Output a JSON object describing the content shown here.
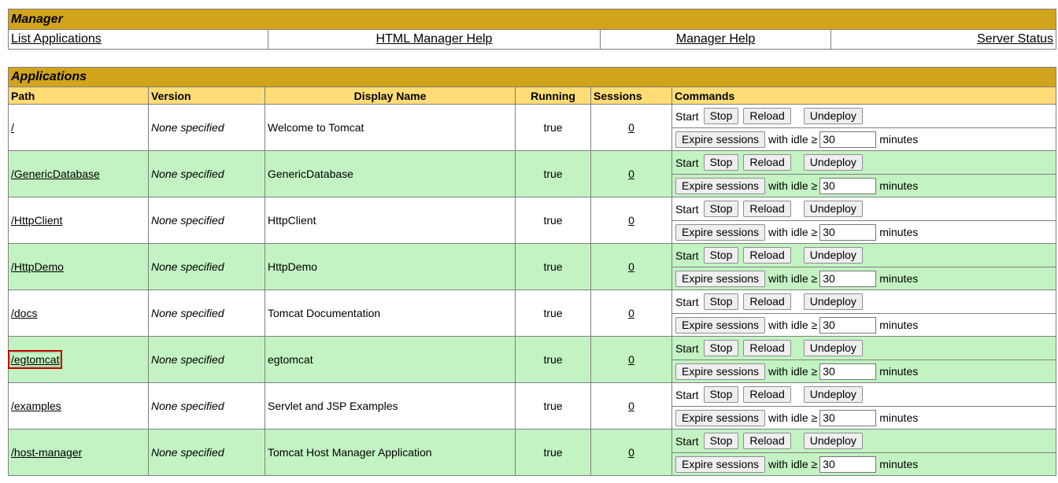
{
  "manager": {
    "title": "Manager",
    "links": [
      "List Applications",
      "HTML Manager Help",
      "Manager Help",
      "Server Status"
    ]
  },
  "applications": {
    "title": "Applications",
    "headers": [
      "Path",
      "Version",
      "Display Name",
      "Running",
      "Sessions",
      "Commands"
    ],
    "labels": {
      "start": "Start",
      "stop": "Stop",
      "reload": "Reload",
      "undeploy": "Undeploy",
      "expire": "Expire sessions",
      "with_idle": "with idle ≥",
      "minutes": "minutes"
    },
    "rows": [
      {
        "path": "/",
        "version": "None specified",
        "display_name": "Welcome to Tomcat",
        "running": "true",
        "sessions": "0",
        "idle": "30"
      },
      {
        "path": "/GenericDatabase",
        "version": "None specified",
        "display_name": "GenericDatabase",
        "running": "true",
        "sessions": "0",
        "idle": "30"
      },
      {
        "path": "/HttpClient",
        "version": "None specified",
        "display_name": "HttpClient",
        "running": "true",
        "sessions": "0",
        "idle": "30"
      },
      {
        "path": "/HttpDemo",
        "version": "None specified",
        "display_name": "HttpDemo",
        "running": "true",
        "sessions": "0",
        "idle": "30"
      },
      {
        "path": "/docs",
        "version": "None specified",
        "display_name": "Tomcat Documentation",
        "running": "true",
        "sessions": "0",
        "idle": "30"
      },
      {
        "path": "/egtomcat",
        "version": "None specified",
        "display_name": "egtomcat",
        "running": "true",
        "sessions": "0",
        "idle": "30"
      },
      {
        "path": "/examples",
        "version": "None specified",
        "display_name": "Servlet and JSP Examples",
        "running": "true",
        "sessions": "0",
        "idle": "30"
      },
      {
        "path": "/host-manager",
        "version": "None specified",
        "display_name": "Tomcat Host Manager Application",
        "running": "true",
        "sessions": "0",
        "idle": "30"
      }
    ]
  },
  "colors": {
    "title_bar": "#D2A41C",
    "header_row": "#FFDC75",
    "row_alt": "#C3F3C3",
    "highlight": "#C00000"
  }
}
